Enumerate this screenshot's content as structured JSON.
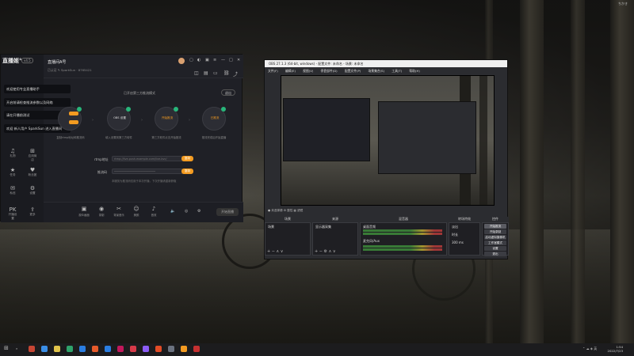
{
  "desktop": {
    "corner_label": "ちかき"
  },
  "streamer_app": {
    "logo": "直播姬°",
    "version": "v4.5",
    "room_title": "直播间A号",
    "room_sub": "已认证 ✎  SparkSun · 8765421",
    "mode_label": "已开启第三方推流模式",
    "exit_label": "退出",
    "tips": [
      "欢迎使用专业直播助手",
      "开启前请检查推流参数以及网络",
      "请在开播前测试",
      "欢迎 新人用户 SparkSun 进入直播间"
    ],
    "side_items": [
      {
        "icon": "♫",
        "label": "礼物"
      },
      {
        "icon": "⊞",
        "label": "应用商店"
      },
      {
        "icon": "★",
        "label": "任务"
      },
      {
        "icon": "♥",
        "label": "粉丝团"
      },
      {
        "icon": "✉",
        "label": "私信"
      },
      {
        "icon": "⚙",
        "label": "设置"
      },
      {
        "icon": "PK",
        "label": "开播设置"
      },
      {
        "icon": "⇪",
        "label": "更多"
      }
    ],
    "steps": [
      {
        "text": "复制",
        "caption": "复制rtmp地址和推流码"
      },
      {
        "text": "OBS 设置",
        "caption": "填入设置到第三方软件"
      },
      {
        "text": "开始推流",
        "caption": "第三方软件点击开始推流"
      },
      {
        "text": "已推流",
        "caption": "推流完成后开始直播"
      }
    ],
    "form": {
      "rtmp_label": "rtmp地址",
      "rtmp_value": "rtmp://live-push.example.com/live-bvc/",
      "key_label": "推流码",
      "key_value": "••••••••••••••••••••••••••",
      "copy_label": "复制",
      "note": "本服务为推流码仅用于本次开播，下次开播请重新获取"
    },
    "bottom_items": [
      {
        "icon": "▣",
        "label": "观众画面"
      },
      {
        "icon": "◉",
        "label": "录制"
      },
      {
        "icon": "✂",
        "label": "背景音乐"
      },
      {
        "icon": "☺",
        "label": "美颜"
      },
      {
        "icon": "♪",
        "label": "音效"
      }
    ],
    "start_label": "开始直播"
  },
  "obs": {
    "title": "OBS 27.1.3 (64-bit, windows) - 配置文件: 未命名 - 场景: 未命名",
    "menu": [
      "文件(F)",
      "编辑(E)",
      "视图(V)",
      "停靠部件(D)",
      "配置文件(P)",
      "场景集合(S)",
      "工具(T)",
      "帮助(H)"
    ],
    "bar_label": "● 未选择源   ⚙ 属性   ▦ 滤镜",
    "docks": {
      "scenes": {
        "header": "场景",
        "items": [
          "场景"
        ]
      },
      "sources": {
        "header": "来源",
        "items": [
          "显示器采集"
        ]
      },
      "mixer": {
        "header": "混音器",
        "channels": [
          {
            "name": "桌面音频",
            "level": "0.0 dB"
          },
          {
            "name": "麦克风/Aux",
            "level": "0.0 dB"
          }
        ]
      },
      "transitions": {
        "header": "转场特效",
        "type": "淡出",
        "duration_label": "时长",
        "duration": "300 ms"
      },
      "controls": {
        "header": "控件",
        "buttons": [
          "开始推流",
          "开始录制",
          "启动虚拟摄像机",
          "工作室模式",
          "设置",
          "退出"
        ]
      }
    },
    "status": "LIVE: 00:00:00  REC: 00:00:00  CPU: 1.4%, 60.00 fps"
  },
  "taskbar": {
    "time": "1:54",
    "date": "2022/7/23",
    "app_colors": [
      "#c74634",
      "#3a8ee6",
      "#e0c34a",
      "#2fa36b",
      "#2a7de1",
      "#e65a2a",
      "#2a7de1",
      "#c2185b",
      "#d73a49",
      "#8b5cf6",
      "#e34c26",
      "#6b7280",
      "#f39b21",
      "#c53030"
    ]
  }
}
